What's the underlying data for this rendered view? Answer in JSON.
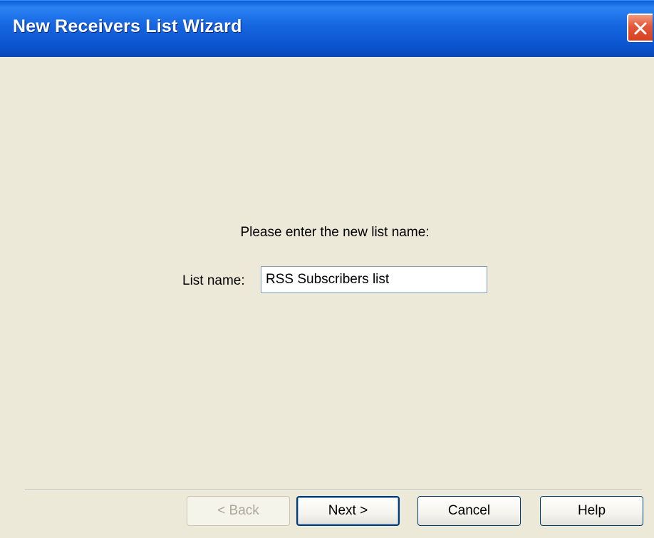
{
  "window": {
    "title": "New Receivers List Wizard"
  },
  "form": {
    "prompt": "Please enter the new list name:",
    "list_name_label": "List name:",
    "list_name_value": "RSS Subscribers list"
  },
  "buttons": {
    "back_label": "< Back",
    "back_enabled": false,
    "next_label": "Next >",
    "cancel_label": "Cancel",
    "help_label": "Help"
  },
  "icons": {
    "close": "close-icon"
  },
  "colors": {
    "titlebar": "#0a52cc",
    "dialog_background": "#ece9d8",
    "close_button": "#d6411f"
  }
}
